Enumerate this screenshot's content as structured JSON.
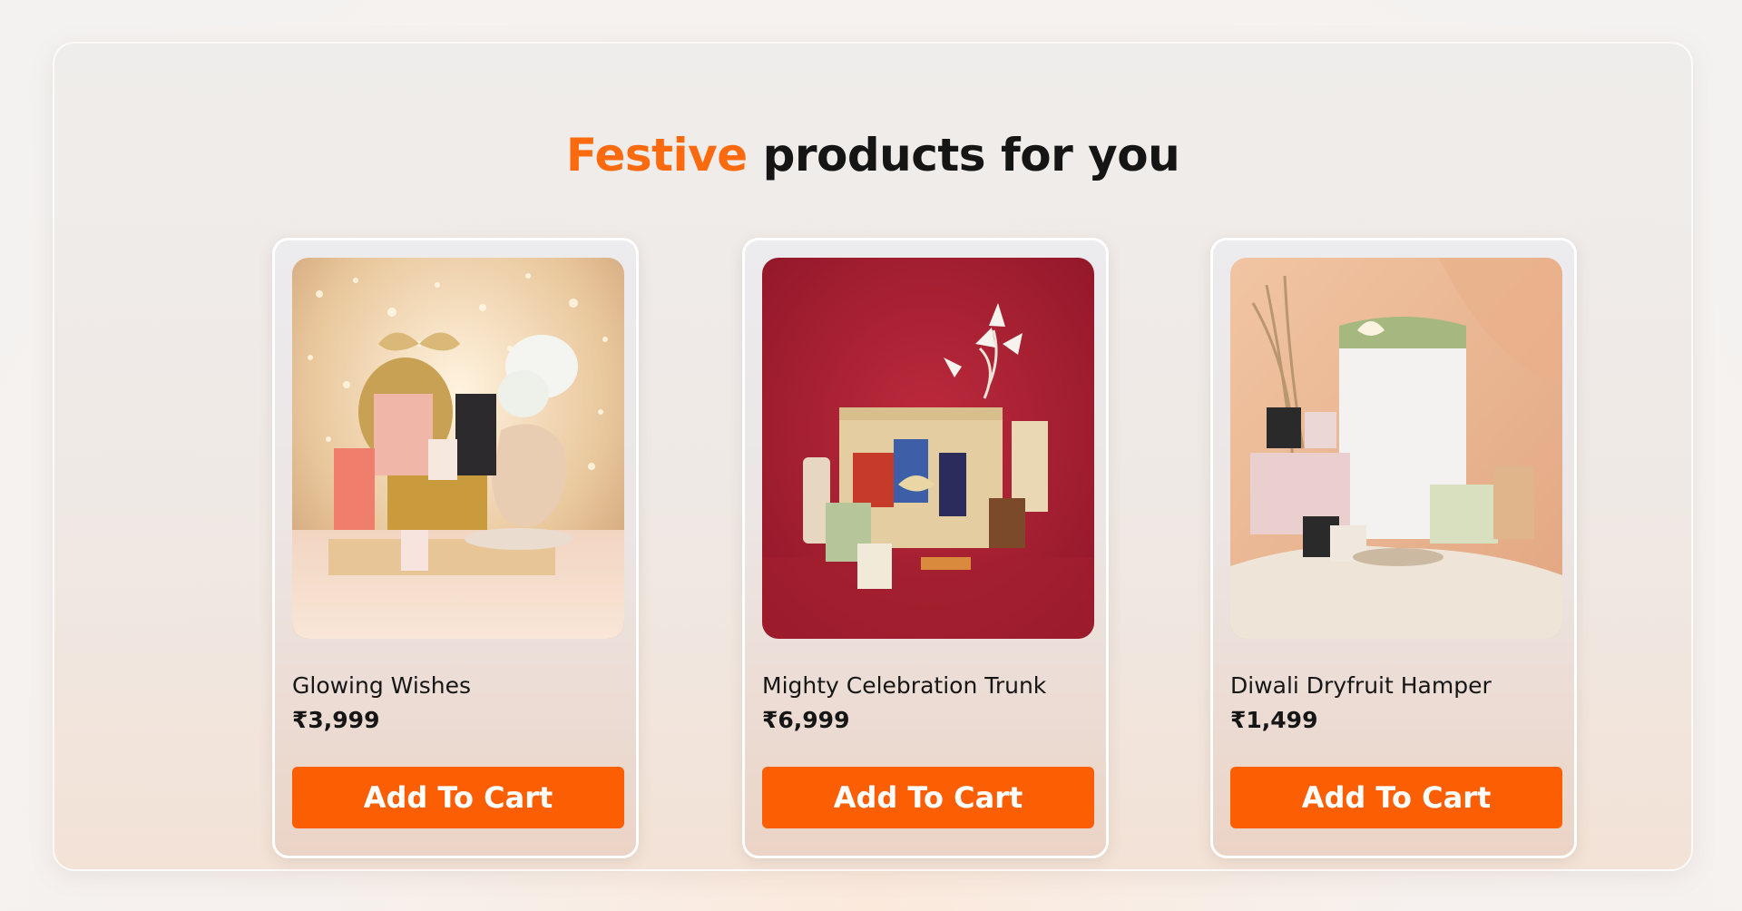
{
  "section": {
    "title_accent": "Festive",
    "title_rest": " products for you",
    "accent_color": "#fc6a10"
  },
  "products": [
    {
      "name": "Glowing Wishes",
      "price": "₹3,999",
      "button_label": "Add To Cart"
    },
    {
      "name": "Mighty Celebration Trunk",
      "price": "₹6,999",
      "button_label": "Add To Cart"
    },
    {
      "name": "Diwali Dryfruit Hamper",
      "price": "₹1,499",
      "button_label": "Add To Cart"
    }
  ],
  "colors": {
    "button": "#fc5f03",
    "text": "#161616"
  }
}
